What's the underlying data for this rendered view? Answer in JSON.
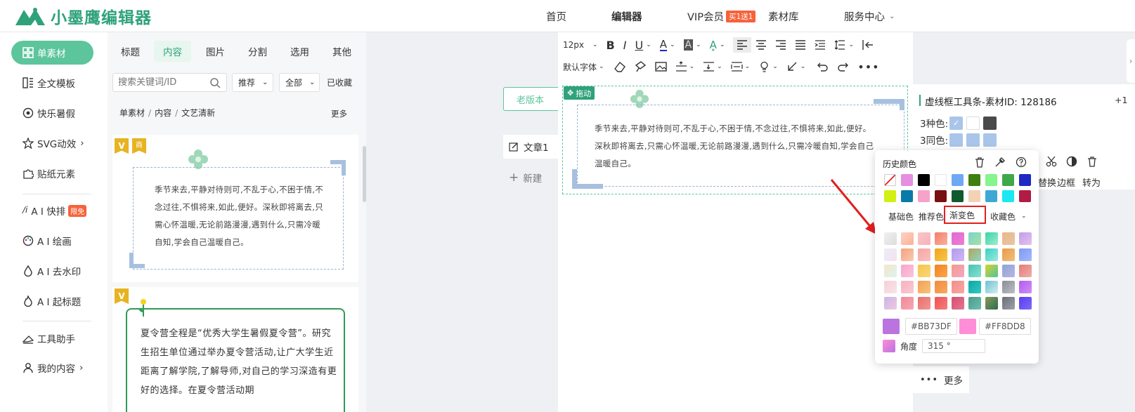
{
  "header": {
    "logo_text": "小墨鹰编辑器",
    "nav": {
      "home": "首页",
      "editor": "编辑器",
      "vip": "VIP会员",
      "vip_badge": "买1送1",
      "library": "素材库",
      "service": "服务中心"
    }
  },
  "leftnav": {
    "items": [
      {
        "label": "单素材",
        "icon": "grid-icon"
      },
      {
        "label": "全文模板",
        "icon": "template-icon"
      },
      {
        "label": "快乐暑假",
        "icon": "ball-icon"
      },
      {
        "label": "SVG动效",
        "icon": "star-icon"
      },
      {
        "label": "贴纸元素",
        "icon": "puzzle-icon"
      },
      {
        "label": "A I 快排",
        "icon": "ai-icon",
        "badge": "限免"
      },
      {
        "label": "A I 绘画",
        "icon": "palette-icon"
      },
      {
        "label": "A I 去水印",
        "icon": "drop-icon"
      },
      {
        "label": "A I 起标题",
        "icon": "fire-icon"
      },
      {
        "label": "工具助手",
        "icon": "tool-icon"
      },
      {
        "label": "我的内容",
        "icon": "user-icon"
      }
    ]
  },
  "panel": {
    "tabs": [
      "标题",
      "内容",
      "图片",
      "分割",
      "选用",
      "其他"
    ],
    "search_placeholder": "搜索关键词/ID",
    "filter_sort": "推荐",
    "filter_all": "全部",
    "favorites": "已收藏",
    "breadcrumb": [
      "单素材",
      "内容",
      "文艺清新"
    ],
    "more": "更多",
    "card1_text": "季节来去,平静对待则可,不乱于心,不困于情,不念过往,不惧将来,如此,便好。深秋即将离去,只需心怀温暖,无论前路漫漫,遇到什么,只需冷暖自知,学会自己温暖自己。",
    "card1_badge_v": "V",
    "card1_badge_shang": "商",
    "card2_badge_v": "V",
    "card2_text": "夏令营全程是“优秀大学生暑假夏令营”。研究生招生单位通过举办夏令营活动,让广大学生近距离了解学院,了解导师,对自己的学习深造有更好的选择。在夏令营活动期"
  },
  "gap": {
    "old_version": "老版本",
    "article": "文章1",
    "new": "新建"
  },
  "editor": {
    "font_size": "12px",
    "default_font": "默认字体",
    "drag_label": "拖动",
    "content": "季节来去,平静对待则可,不乱于心,不困于情,不念过往,不惧将来,如此,便好。深秋即将离去,只需心怀温暖,无论前路漫漫,遇到什么,只需冷暖自知,学会自己温暖自己。"
  },
  "props": {
    "title": "虚线框工具条-素材ID: 128186",
    "plus": "+1",
    "three_colors": "3种色:",
    "three_same": "3同色:",
    "actions": [
      "替换",
      "边框",
      "转为"
    ],
    "more": "更多"
  },
  "picker": {
    "history_title": "历史颜色",
    "history_colors": [
      "#e58fe0",
      "#000000",
      "#ffffff",
      "#6fa8f5",
      "#3f7f10",
      "#85f58c",
      "#3ea84b",
      "#1f28c3",
      "#d2f014",
      "#0a7aa8",
      "#f7a2c8",
      "#7a0f0f",
      "#0f5a2e",
      "#f3d2b6",
      "#3ea8d4",
      "#1be8f2",
      "#b01c46"
    ],
    "tabs": [
      "基础色",
      "推荐色",
      "渐变色",
      "收藏色"
    ],
    "gradients": [
      [
        "#f0f0f0",
        "#ddd"
      ],
      [
        "#fbd3c1",
        "#fdb09a"
      ],
      [
        "#f9c7c5",
        "#f8b0bc"
      ],
      [
        "#f57c6c",
        "#f9b19c"
      ],
      [
        "#dd6bd9",
        "#f07cce"
      ],
      [
        "#7ad4c5",
        "#a6e1a8"
      ],
      [
        "#36d4a8",
        "#a0eccd"
      ],
      [
        "#e8b789",
        "#e8c6a4"
      ],
      [
        "#c29ee6",
        "#e3c2f0"
      ],
      [
        "#e8eef8",
        "#f7e1f0"
      ],
      [
        "#f7a07e",
        "#f7cbb0"
      ],
      [
        "#f6a6a3",
        "#f8c0c0"
      ],
      [
        "#f3a21d",
        "#f6c74a"
      ],
      [
        "#b39cef",
        "#d0b5f6"
      ],
      [
        "#b0a45c",
        "#8dd7c2"
      ],
      [
        "#39d0c4",
        "#9ee9dd"
      ],
      [
        "#e89a4a",
        "#f2c07b"
      ],
      [
        "#7d9af7",
        "#a7b8fb"
      ],
      [
        "#f2e8c8",
        "#dff2f0"
      ],
      [
        "#f7a6c9",
        "#fbc4dc"
      ],
      [
        "#f7c44a",
        "#f9d77a"
      ],
      [
        "#f58025",
        "#f8a84a"
      ],
      [
        "#f59a88",
        "#f2a7c6"
      ],
      [
        "#47c2b2",
        "#88e1cf"
      ],
      [
        "#d6d32a",
        "#4ec5a0"
      ],
      [
        "#8fa3d1",
        "#b9b5e8"
      ],
      [
        "#e47a7a",
        "#eeb1a8"
      ],
      [
        "#f5d0d6",
        "#f7e4e8"
      ],
      [
        "#f6b3bf",
        "#f9c9d1"
      ],
      [
        "#f59e55",
        "#f6c47a"
      ],
      [
        "#f48a3c",
        "#f6aa60"
      ],
      [
        "#f58c8c",
        "#f7a8a0"
      ],
      [
        "#0aa8a5",
        "#35c7c1"
      ],
      [
        "#6ec1d0",
        "#d2eef0"
      ],
      [
        "#8b8d96",
        "#bcbfc6"
      ],
      [
        "#b15cf0",
        "#cf8ff6"
      ],
      [
        "#c7b7e8",
        "#f2c7e0"
      ],
      [
        "#f08898",
        "#f6a8b2"
      ],
      [
        "#e76f6f",
        "#f0978f"
      ],
      [
        "#f05252",
        "#f47e7e"
      ],
      [
        "#d64d70",
        "#e57691"
      ],
      [
        "#4b9a8b",
        "#6fbfae"
      ],
      [
        "#8a9a55",
        "#2e6b55"
      ],
      [
        "#6b6e77",
        "#9da2ab"
      ],
      [
        "#5b3df2",
        "#7c6bf7"
      ]
    ],
    "color1_swatch": "#BB73DF",
    "color1": "#BB73DF",
    "color2_swatch": "#FF8DD8",
    "color2": "#FF8DD8",
    "angle_label": "角度",
    "angle_value": "315 °"
  }
}
